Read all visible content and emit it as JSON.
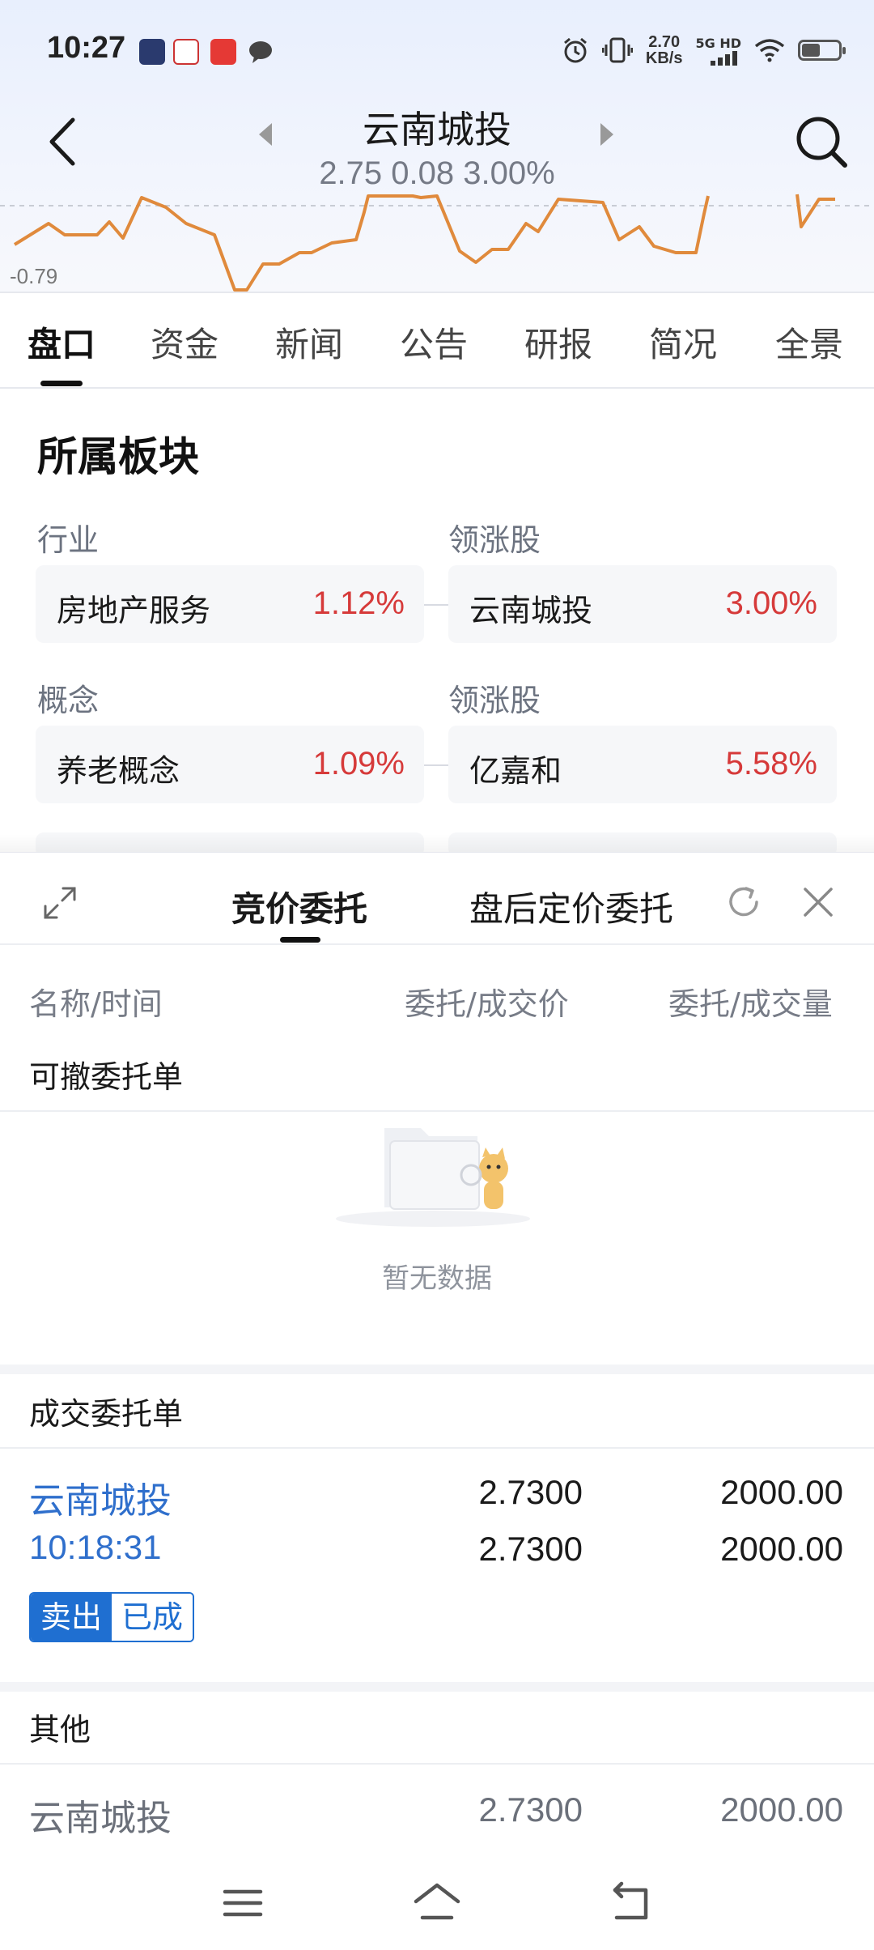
{
  "status_bar": {
    "time": "10:27",
    "net_speed_value": "2.70",
    "net_speed_unit": "KB/s",
    "network": "5G HD",
    "icons": [
      "app-icon-1",
      "app-icon-2",
      "app-icon-3",
      "message-icon",
      "alarm-icon",
      "vibrate-icon",
      "signal-icon",
      "wifi-icon",
      "battery-icon"
    ]
  },
  "header": {
    "title": "云南城投",
    "price_line": "2.75 0.08 3.00%",
    "icons": [
      "back-icon",
      "prev-stock-icon",
      "next-stock-icon",
      "search-icon"
    ]
  },
  "mini_chart": {
    "low_label": "-0.79",
    "line_color": "#e08a3c"
  },
  "tabs": [
    "盘口",
    "资金",
    "新闻",
    "公告",
    "研报",
    "简况",
    "全景"
  ],
  "sector": {
    "title": "所属板块",
    "rows": [
      {
        "left_label": "行业",
        "right_label": "领涨股",
        "left_name": "房地产服务",
        "left_pct": "1.12%",
        "right_name": "云南城投",
        "right_pct": "3.00%"
      },
      {
        "left_label": "概念",
        "right_label": "领涨股",
        "left_name": "养老概念",
        "left_pct": "1.09%",
        "right_name": "亿嘉和",
        "right_pct": "5.58%"
      }
    ]
  },
  "sheet": {
    "tabs": [
      "竞价委托",
      "盘后定价委托"
    ],
    "columns": [
      "名称/时间",
      "委托/成交价",
      "委托/成交量"
    ],
    "cancelable_title": "可撤委托单",
    "empty_text": "暂无数据",
    "filled_title": "成交委托单",
    "filled_order": {
      "name": "云南城投",
      "time": "10:18:31",
      "order_price": "2.7300",
      "deal_price": "2.7300",
      "order_qty": "2000.00",
      "deal_qty": "2000.00",
      "tag_direction": "卖出",
      "tag_status": "已成"
    },
    "other_title": "其他",
    "other_order": {
      "name": "云南城投",
      "price": "2.7300",
      "qty": "2000.00"
    }
  },
  "navbar": {
    "icons": [
      "menu-icon",
      "home-icon",
      "back-nav-icon"
    ]
  },
  "colors": {
    "accent_blue": "#1f6fd1",
    "up_red": "#d63a3a",
    "chart_orange": "#e08a3c"
  }
}
